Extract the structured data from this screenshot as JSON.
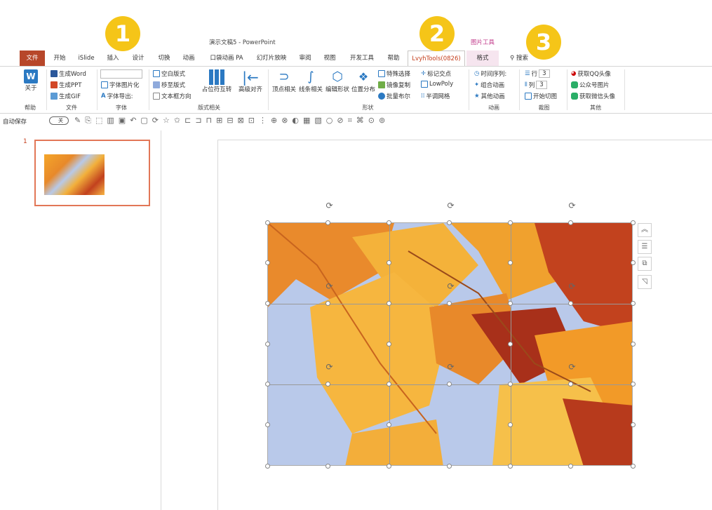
{
  "window": {
    "title": "演示文稿5 - PowerPoint",
    "context_label": "图片工具"
  },
  "tabs": [
    "文件",
    "开始",
    "iSlide",
    "插入",
    "设计",
    "切换",
    "动画",
    "口袋动画 PA",
    "幻灯片放映",
    "审阅",
    "视图",
    "开发工具",
    "帮助",
    "LvyhTools(0826)",
    "格式"
  ],
  "search_label": "搜索",
  "callouts": [
    "1",
    "2",
    "3"
  ],
  "ribbon": {
    "help": {
      "about": "关于",
      "group": "帮助"
    },
    "file": {
      "word": "生成Word",
      "ppt": "生成PPT",
      "gif": "生成GIF",
      "group": "文件"
    },
    "font": {
      "font_img": "字体图片化",
      "font_export": "字体导出:",
      "group": "字体"
    },
    "layout": {
      "blank": "空白版式",
      "move": "移至版式",
      "text_dir": "文本框方向",
      "placeholder_swap": "占位符互转",
      "adv_align": "高级对齐",
      "group": "版式相关"
    },
    "shape": {
      "vertex": "顶点相关",
      "line": "线条相关",
      "edit_shape": "编辑形状",
      "position": "位置分布",
      "special_select": "特殊选择",
      "mirror_copy": "镜像复制",
      "boolean": "批量布尔",
      "mark_intersect": "标记交点",
      "lowpoly": "LowPoly",
      "half_grid": "半调网格",
      "group": "形状"
    },
    "anim": {
      "timeline": "时间序列:",
      "combo": "组合动画",
      "other": "其他动画",
      "group": "动画"
    },
    "crop": {
      "row_label": "行",
      "row_value": "3",
      "col_label": "列",
      "col_value": "3",
      "start": "开始切图",
      "group": "裁图"
    },
    "other": {
      "qq": "获取QQ头像",
      "gzh": "公众号图片",
      "wx": "获取微信头像",
      "group": "其他"
    }
  },
  "qat": {
    "autosave_label": "自动保存",
    "toggle_state": "关"
  },
  "slides": {
    "number": "1"
  },
  "colors": {
    "accent": "#c43e1c",
    "file_tab": "#b7472a",
    "callout": "#f5c518",
    "context": "#c0398a"
  }
}
